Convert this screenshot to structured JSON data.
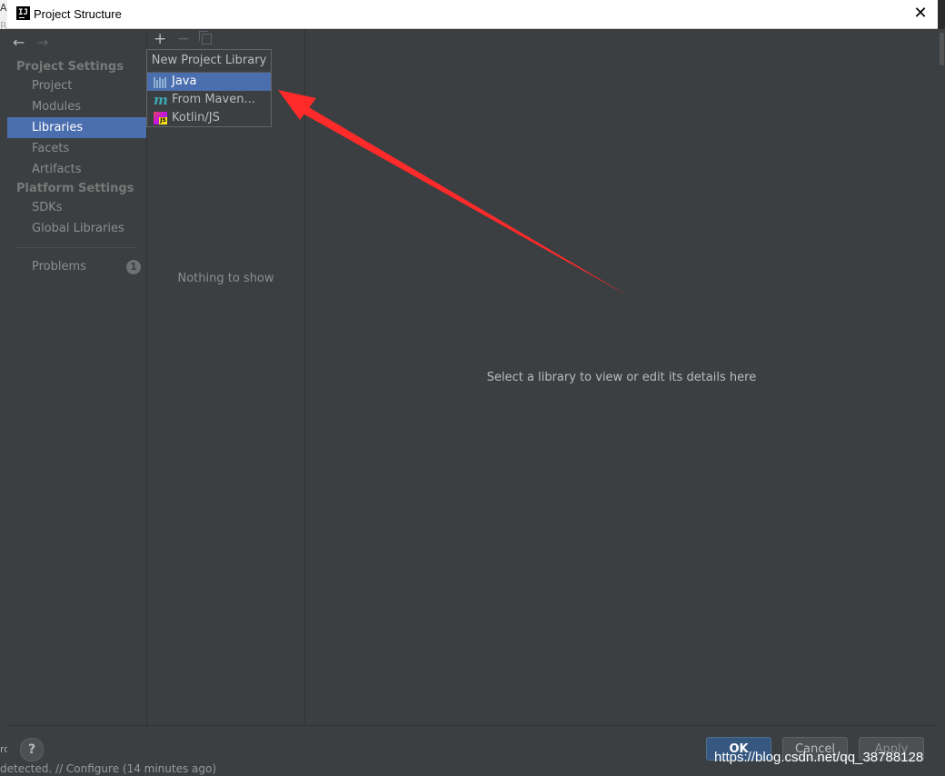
{
  "window": {
    "title": "Project Structure",
    "close_glyph": "✕"
  },
  "background": {
    "bottom_status": "detected. // Configure (14 minutes ago)",
    "edge_top": "A",
    "edge_second": "R",
    "edge_bottom": "ro"
  },
  "sidebar": {
    "back_glyph": "←",
    "forward_glyph": "→",
    "project_settings_header": "Project Settings",
    "platform_settings_header": "Platform Settings",
    "items": {
      "project": "Project",
      "modules": "Modules",
      "libraries": "Libraries",
      "facets": "Facets",
      "artifacts": "Artifacts",
      "sdks": "SDKs",
      "global_libraries": "Global Libraries",
      "problems": "Problems"
    },
    "problems_count": "1",
    "selected": "Libraries"
  },
  "list_panel": {
    "add_glyph": "+",
    "remove_glyph": "−",
    "empty_text": "Nothing to show"
  },
  "popup": {
    "title": "New Project Library",
    "items": {
      "java": "Java",
      "maven": "From Maven...",
      "kotlin_js": "Kotlin/JS"
    },
    "selected": "Java",
    "maven_glyph": "m",
    "js_glyph": "JS"
  },
  "details": {
    "placeholder": "Select a library to view or edit its details here"
  },
  "footer": {
    "help_glyph": "?",
    "ok_label": "OK",
    "cancel_label": "Cancel",
    "apply_label": "Apply"
  },
  "watermark": "https://blog.csdn.net/qq_38788128",
  "colors": {
    "selection": "#4b6eaf",
    "panel_bg": "#3c3f41",
    "annotation_arrow": "#ff2a2a",
    "ok_button": "#365880"
  }
}
